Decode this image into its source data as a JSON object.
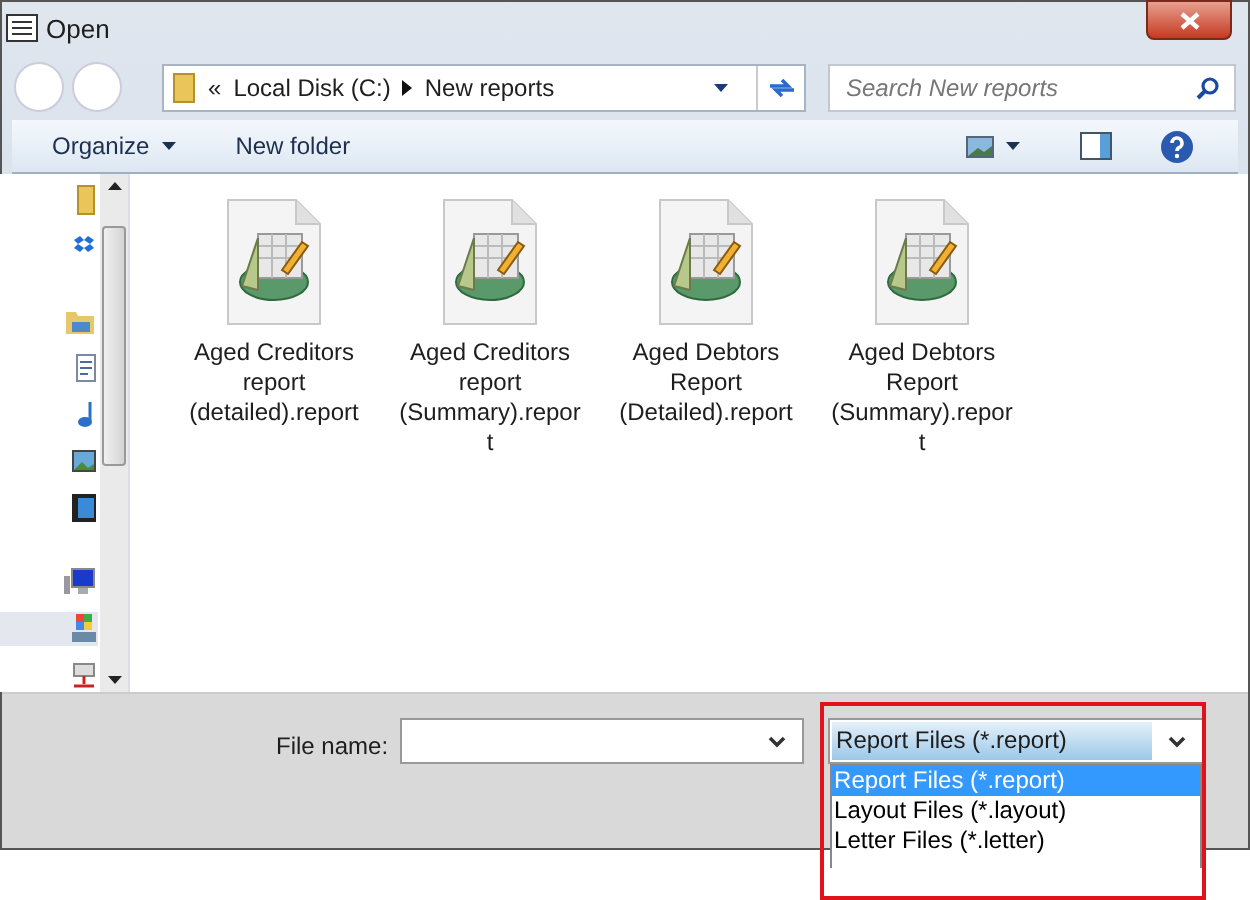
{
  "window": {
    "title": "Open"
  },
  "address": {
    "overflow": "«",
    "crumbs": [
      {
        "label": "Local Disk (C:)"
      },
      {
        "label": "New reports"
      }
    ]
  },
  "search": {
    "placeholder": "Search New reports"
  },
  "toolbar": {
    "organize": "Organize",
    "new_folder": "New folder"
  },
  "sidebar": {
    "items": [
      {
        "kind": "folder",
        "selected": false
      },
      {
        "kind": "dropbox",
        "selected": false
      },
      {
        "kind": "libraries",
        "selected": false
      },
      {
        "kind": "document",
        "selected": false
      },
      {
        "kind": "music",
        "selected": false
      },
      {
        "kind": "pictures",
        "selected": false
      },
      {
        "kind": "video",
        "selected": false
      },
      {
        "kind": "computer",
        "selected": false
      },
      {
        "kind": "disk",
        "selected": true
      },
      {
        "kind": "network",
        "selected": false
      }
    ]
  },
  "files": [
    {
      "name": "Aged Creditors report (detailed).report"
    },
    {
      "name": "Aged Creditors report (Summary).report"
    },
    {
      "name": "Aged Debtors Report (Detailed).report"
    },
    {
      "name": "Aged Debtors Report (Summary).report"
    }
  ],
  "footer": {
    "file_name_label": "File name:",
    "file_type": "Report Files (*.report)",
    "options": [
      {
        "label": "Report Files (*.report)",
        "selected": true
      },
      {
        "label": "Layout Files (*.layout)",
        "selected": false
      },
      {
        "label": "Letter Files (*.letter)",
        "selected": false
      }
    ]
  }
}
